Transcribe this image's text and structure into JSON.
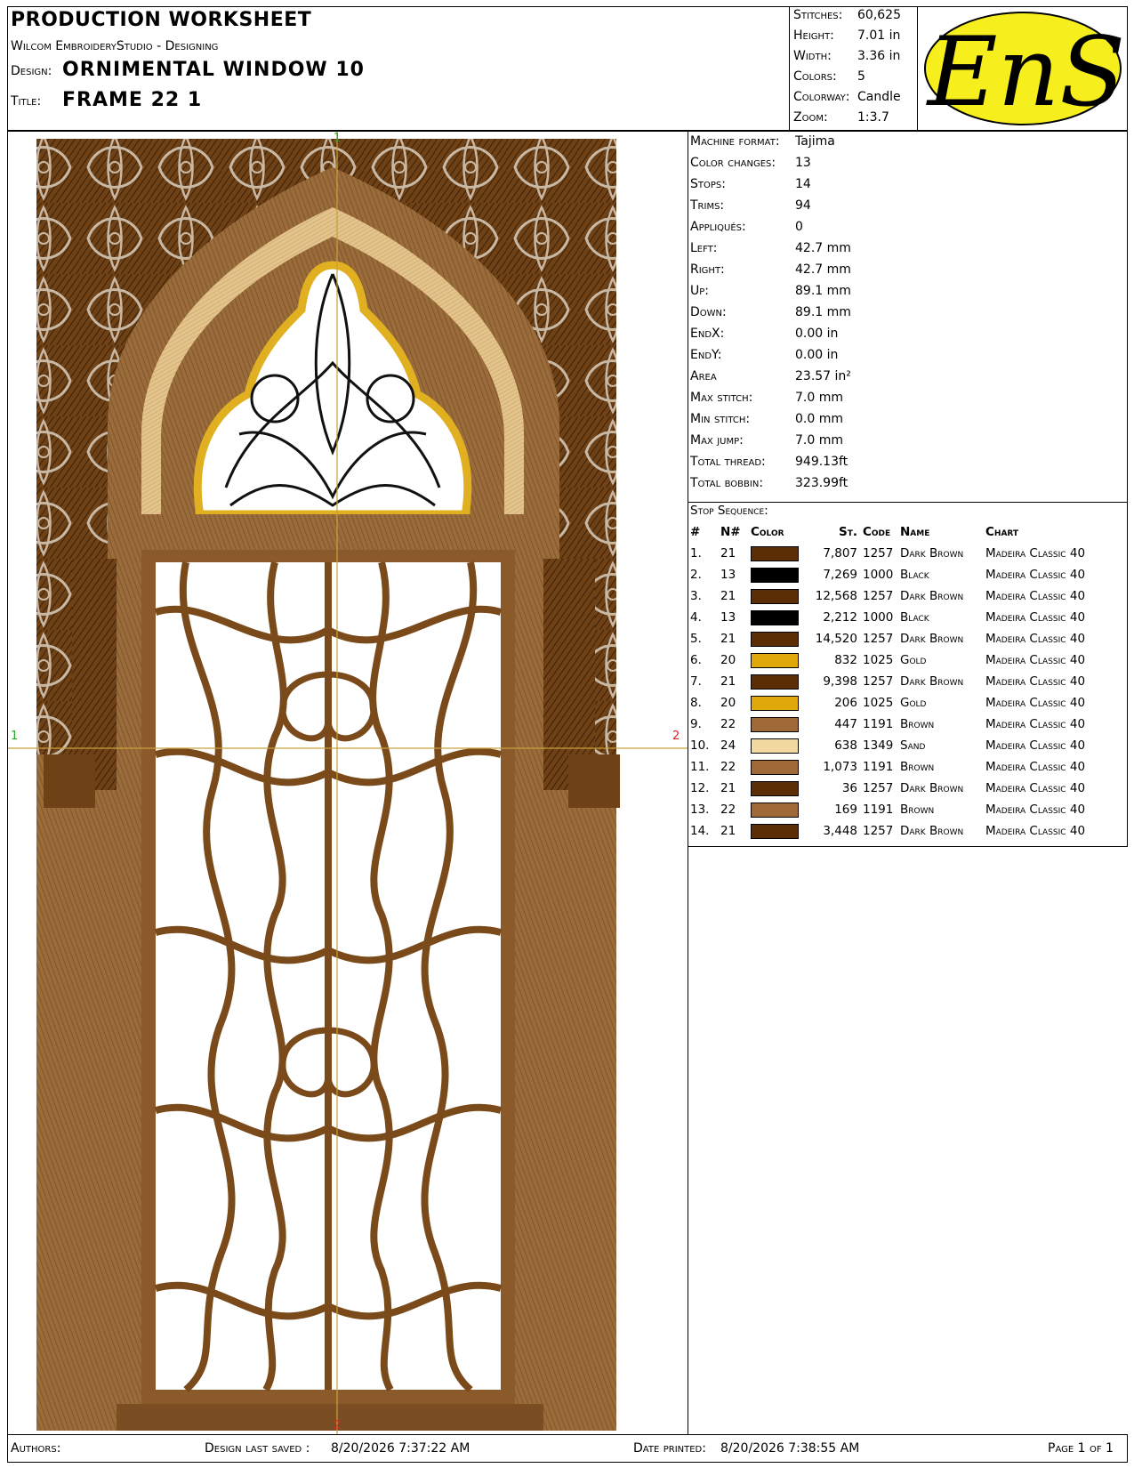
{
  "header": {
    "sheet_title": "PRODUCTION WORKSHEET",
    "software": "Wilcom EmbroideryStudio - Designing",
    "design_label": "Design:",
    "design_value": "ORNIMENTAL WINDOW  10",
    "title_label": "Title:",
    "title_value": "FRAME 22  1"
  },
  "stats": [
    {
      "label": "Stitches:",
      "value": "60,625"
    },
    {
      "label": "Height:",
      "value": "7.01 in"
    },
    {
      "label": "Width:",
      "value": "3.36 in"
    },
    {
      "label": "Colors:",
      "value": "5"
    },
    {
      "label": "Colorway:",
      "value": "Candle"
    },
    {
      "label": "Zoom:",
      "value": "1:3.7"
    }
  ],
  "logo": {
    "text": "EnS",
    "bg": "#f7ee1d",
    "fg": "#000000"
  },
  "machine": [
    {
      "label": "Machine format:",
      "value": "Tajima"
    },
    {
      "label": "Color changes:",
      "value": "13"
    },
    {
      "label": "Stops:",
      "value": "14"
    },
    {
      "label": "Trims:",
      "value": "94"
    },
    {
      "label": "Appliqués:",
      "value": "0"
    },
    {
      "label": "Left:",
      "value": "42.7 mm"
    },
    {
      "label": "Right:",
      "value": "42.7 mm"
    },
    {
      "label": "Up:",
      "value": "89.1 mm"
    },
    {
      "label": "Down:",
      "value": "89.1 mm"
    },
    {
      "label": "EndX:",
      "value": "0.00 in"
    },
    {
      "label": "EndY:",
      "value": "0.00 in"
    },
    {
      "label": "Area",
      "value": " 23.57 in²"
    },
    {
      "label": "Max stitch:",
      "value": "7.0 mm"
    },
    {
      "label": "Min stitch:",
      "value": "0.0 mm"
    },
    {
      "label": "Max jump:",
      "value": "7.0 mm"
    },
    {
      "label": "Total thread:",
      "value": "949.13ft"
    },
    {
      "label": "Total bobbin:",
      "value": "323.99ft"
    }
  ],
  "stop_sequence": {
    "title": "Stop Sequence:",
    "headers": [
      "#",
      "N#",
      "Color",
      "St.",
      "Code",
      "Name",
      "Chart"
    ],
    "rows": [
      {
        "n": "1.",
        "needle": "21",
        "color": "#5c2e06",
        "st": "7,807",
        "code": "1257",
        "name": "Dark Brown",
        "chart": "Madeira Classic 40"
      },
      {
        "n": "2.",
        "needle": "13",
        "color": "#000000",
        "st": "7,269",
        "code": "1000",
        "name": "Black",
        "chart": "Madeira Classic 40"
      },
      {
        "n": "3.",
        "needle": "21",
        "color": "#5c2e06",
        "st": "12,568",
        "code": "1257",
        "name": "Dark Brown",
        "chart": "Madeira Classic 40"
      },
      {
        "n": "4.",
        "needle": "13",
        "color": "#000000",
        "st": "2,212",
        "code": "1000",
        "name": "Black",
        "chart": "Madeira Classic 40"
      },
      {
        "n": "5.",
        "needle": "21",
        "color": "#5c2e06",
        "st": "14,520",
        "code": "1257",
        "name": "Dark Brown",
        "chart": "Madeira Classic 40"
      },
      {
        "n": "6.",
        "needle": "20",
        "color": "#e0a80a",
        "st": "832",
        "code": "1025",
        "name": "Gold",
        "chart": "Madeira Classic 40"
      },
      {
        "n": "7.",
        "needle": "21",
        "color": "#5c2e06",
        "st": "9,398",
        "code": "1257",
        "name": "Dark Brown",
        "chart": "Madeira Classic 40"
      },
      {
        "n": "8.",
        "needle": "20",
        "color": "#e0a80a",
        "st": "206",
        "code": "1025",
        "name": "Gold",
        "chart": "Madeira Classic 40"
      },
      {
        "n": "9.",
        "needle": "22",
        "color": "#a06a38",
        "st": "447",
        "code": "1191",
        "name": "Brown",
        "chart": "Madeira Classic 40"
      },
      {
        "n": "10.",
        "needle": "24",
        "color": "#f2d9a0",
        "st": "638",
        "code": "1349",
        "name": "Sand",
        "chart": "Madeira Classic 40"
      },
      {
        "n": "11.",
        "needle": "22",
        "color": "#a06a38",
        "st": "1,073",
        "code": "1191",
        "name": "Brown",
        "chart": "Madeira Classic 40"
      },
      {
        "n": "12.",
        "needle": "21",
        "color": "#5c2e06",
        "st": "36",
        "code": "1257",
        "name": "Dark Brown",
        "chart": "Madeira Classic 40"
      },
      {
        "n": "13.",
        "needle": "22",
        "color": "#a06a38",
        "st": "169",
        "code": "1191",
        "name": "Brown",
        "chart": "Madeira Classic 40"
      },
      {
        "n": "14.",
        "needle": "21",
        "color": "#5c2e06",
        "st": "3,448",
        "code": "1257",
        "name": "Dark Brown",
        "chart": "Madeira Classic 40"
      }
    ]
  },
  "preview": {
    "markers": {
      "top": "1",
      "bottom": "2",
      "left": "1",
      "right": "2"
    },
    "colors": {
      "dark": "#5c2e06",
      "mid": "#8a5a2b",
      "light": "#a06a38",
      "sand": "#e8c88a",
      "gold": "#e0b020"
    }
  },
  "footer": {
    "authors": "Authors:",
    "saved_label": "Design last saved :",
    "saved_value": "8/20/2026 7:37:22 AM",
    "printed_label": "Date printed:",
    "printed_value": "8/20/2026 7:38:55 AM",
    "page": "Page 1 of 1"
  }
}
